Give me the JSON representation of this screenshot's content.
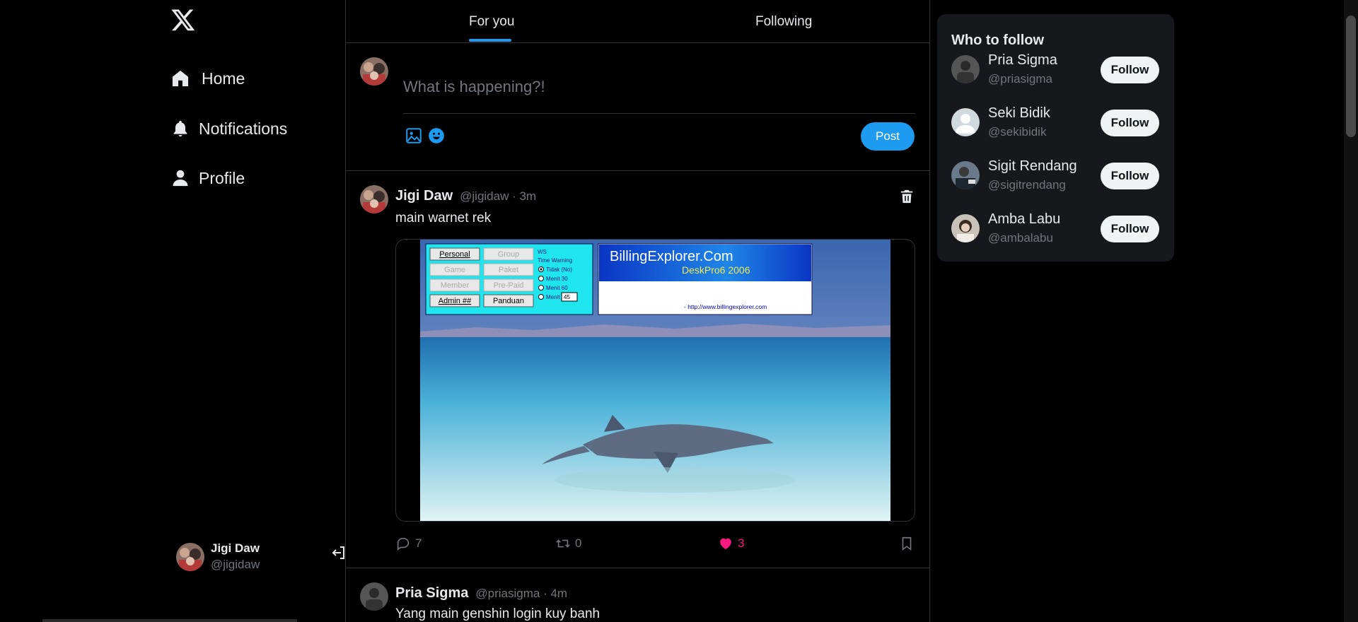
{
  "app": {
    "logo_icon": "x-logo-icon",
    "accent_color": "#1d9bf0",
    "like_color": "#f91880"
  },
  "sidebar": {
    "items": [
      {
        "label": "Home",
        "icon": "home-icon"
      },
      {
        "label": "Notifications",
        "icon": "bell-icon"
      },
      {
        "label": "Profile",
        "icon": "person-icon"
      }
    ],
    "account": {
      "name": "Jigi Daw",
      "handle": "@jigidaw",
      "logout_icon": "logout-icon"
    }
  },
  "tabs": [
    {
      "label": "For you",
      "active": true
    },
    {
      "label": "Following",
      "active": false
    }
  ],
  "compose": {
    "placeholder": "What is happening?!",
    "value": "",
    "post_label": "Post"
  },
  "tweets": [
    {
      "name": "Jigi Daw",
      "meta": "@jigidaw · 3m",
      "text": "main warnet rek",
      "media": {
        "buttons": [
          "Personal",
          "Group",
          "Game",
          "Paket",
          "Member",
          "Pre-Paid",
          "Admin ##",
          "Panduan"
        ],
        "ws_label": "WS",
        "warning_title": "Time Warning",
        "options": [
          "Tidak (No)",
          "Menit  30",
          "Menit  60",
          "Menit"
        ],
        "minutes_value": "45",
        "brand": "BillingExplorer.Com",
        "product": "DeskPro6 2006",
        "url": "- http://www.billingexplorer.com"
      },
      "replies": "7",
      "retweets": "0",
      "likes": "3"
    },
    {
      "name": "Pria Sigma",
      "meta": "@priasigma · 4m",
      "text": "Yang main genshin login kuy banh"
    }
  ],
  "who_to_follow": {
    "title": "Who to follow",
    "follow_label": "Follow",
    "users": [
      {
        "name": "Pria Sigma",
        "handle": "@priasigma"
      },
      {
        "name": "Seki Bidik",
        "handle": "@sekibidik"
      },
      {
        "name": "Sigit Rendang",
        "handle": "@sigitrendang"
      },
      {
        "name": "Amba Labu",
        "handle": "@ambalabu"
      }
    ]
  }
}
